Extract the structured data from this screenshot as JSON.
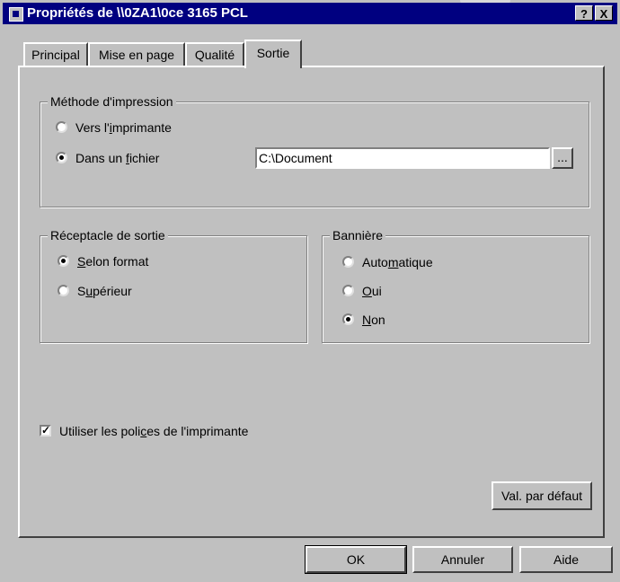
{
  "window": {
    "title": "Propriétés de \\\\0ZA1\\0ce 3165 PCL",
    "help_button": "?",
    "close_button": "X"
  },
  "tabs": [
    {
      "label": "Principal",
      "active": false
    },
    {
      "label": "Mise en page",
      "active": false
    },
    {
      "label": "Qualité",
      "active": false
    },
    {
      "label": "Sortie",
      "active": true
    }
  ],
  "print_method": {
    "group_label": "Méthode d'impression",
    "option_printer": {
      "pre": "Vers l'",
      "key": "i",
      "post": "mprimante",
      "selected": false
    },
    "option_file": {
      "pre": "Dans un ",
      "key": "f",
      "post": "ichier",
      "selected": true
    },
    "file_path": "C:\\Document",
    "browse_label": "..."
  },
  "output_tray": {
    "group_label": "Réceptacle de sortie",
    "option_format": {
      "pre": "",
      "key": "S",
      "post": "elon format",
      "selected": true
    },
    "option_upper": {
      "pre": "S",
      "key": "u",
      "post": "périeur",
      "selected": false
    }
  },
  "banner": {
    "group_label": "Bannière",
    "option_auto": {
      "pre": "Auto",
      "key": "m",
      "post": "atique",
      "selected": false
    },
    "option_yes": {
      "pre": "",
      "key": "O",
      "post": "ui",
      "selected": false
    },
    "option_no": {
      "pre": "",
      "key": "N",
      "post": "on",
      "selected": true
    }
  },
  "printer_fonts": {
    "pre": "Utiliser les poli",
    "key": "c",
    "post": "es de l'imprimante",
    "checked": true,
    "check_mark": "✓"
  },
  "buttons": {
    "defaults": "Val. par défaut",
    "ok": "OK",
    "cancel": "Annuler",
    "help": "Aide"
  }
}
